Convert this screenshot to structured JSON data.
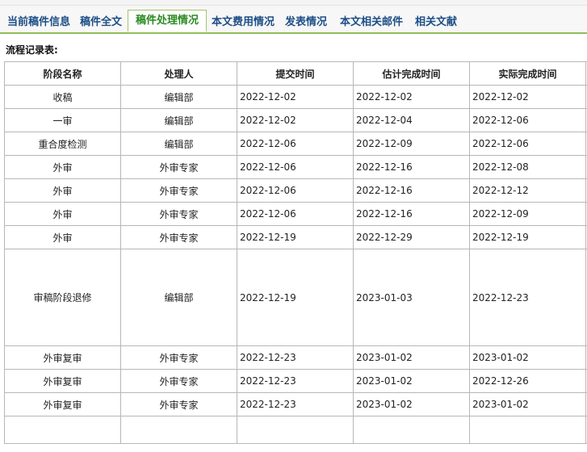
{
  "tabs": [
    {
      "label": "当前稿件信息",
      "active": false
    },
    {
      "label": "稿件全文",
      "active": false
    },
    {
      "label": "稿件处理情况",
      "active": true
    },
    {
      "label": "本文费用情况",
      "active": false
    },
    {
      "label": "发表情况",
      "active": false
    },
    {
      "label": "本文相关邮件",
      "active": false
    },
    {
      "label": "相关文献",
      "active": false
    }
  ],
  "section_title": "流程记录表:",
  "table": {
    "headers": [
      "阶段名称",
      "处理人",
      "提交时间",
      "估计完成时间",
      "实际完成时间"
    ],
    "rows": [
      [
        "收稿",
        "编辑部",
        "2022-12-02",
        "2022-12-02",
        "2022-12-02"
      ],
      [
        "一审",
        "编辑部",
        "2022-12-02",
        "2022-12-04",
        "2022-12-06"
      ],
      [
        "重合度检测",
        "编辑部",
        "2022-12-06",
        "2022-12-09",
        "2022-12-06"
      ],
      [
        "外审",
        "外审专家",
        "2022-12-06",
        "2022-12-16",
        "2022-12-08"
      ],
      [
        "外审",
        "外审专家",
        "2022-12-06",
        "2022-12-16",
        "2022-12-12"
      ],
      [
        "外审",
        "外审专家",
        "2022-12-06",
        "2022-12-16",
        "2022-12-09"
      ],
      [
        "外审",
        "外审专家",
        "2022-12-19",
        "2022-12-29",
        "2022-12-19"
      ],
      [
        "审稿阶段退修",
        "编辑部",
        "2022-12-19",
        "2023-01-03",
        "2022-12-23"
      ],
      [
        "外审复审",
        "外审专家",
        "2022-12-23",
        "2023-01-02",
        "2023-01-02"
      ],
      [
        "外审复审",
        "外审专家",
        "2022-12-23",
        "2023-01-02",
        "2022-12-26"
      ],
      [
        "外审复审",
        "外审专家",
        "2022-12-23",
        "2023-01-02",
        "2023-01-02"
      ]
    ]
  },
  "colors": {
    "tab_text": "#1c4e86",
    "tab_active_text": "#2a8a20",
    "tab_underline": "#8fbf5a",
    "grid": "#b7b7b7"
  }
}
